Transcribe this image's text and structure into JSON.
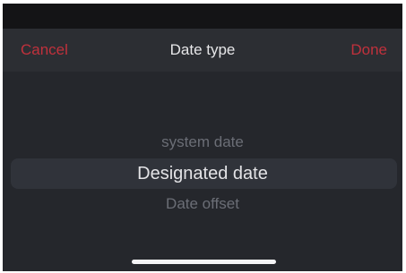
{
  "header": {
    "cancel_label": "Cancel",
    "title": "Date type",
    "done_label": "Done"
  },
  "picker": {
    "options": [
      {
        "label": "system date"
      },
      {
        "label": "Designated date"
      },
      {
        "label": "Date offset"
      }
    ],
    "selected": "Designated date"
  },
  "colors": {
    "accent": "#c0313c",
    "sheet_background": "#25272c",
    "header_background": "#2c2e33",
    "status_bar": "#141416"
  }
}
